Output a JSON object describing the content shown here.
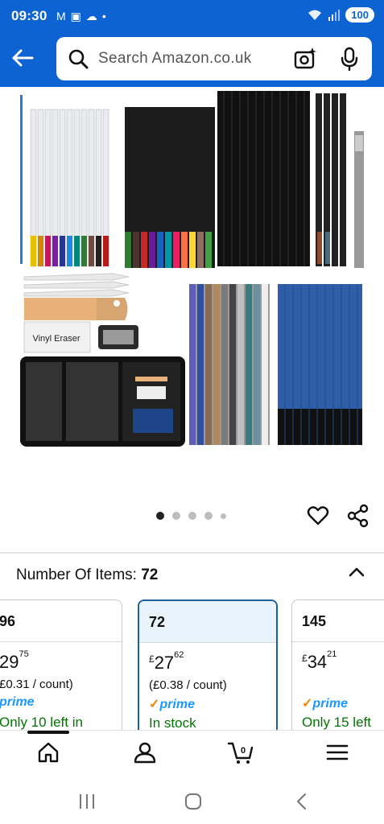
{
  "status": {
    "time": "09:30",
    "battery": "100"
  },
  "search": {
    "placeholder": "Search Amazon.co.uk"
  },
  "product_image": {
    "eraser_label": "Vinyl Eraser"
  },
  "variant": {
    "label": "Number Of Items:",
    "value": "72",
    "options": [
      {
        "title": "96",
        "price_currency": "£",
        "price_whole": "29",
        "price_fraction": "75",
        "per_count": "£0.31 / count)",
        "prime": "prime",
        "stock": "Only 10 left in"
      },
      {
        "title": "72",
        "price_currency": "£",
        "price_whole": "27",
        "price_fraction": "62",
        "per_count": "(£0.38 / count)",
        "prime": "prime",
        "stock": "In stock"
      },
      {
        "title": "145",
        "price_currency": "£",
        "price_whole": "34",
        "price_fraction": "21",
        "per_count": "",
        "prime": "prime",
        "stock": "Only 15 left"
      }
    ]
  },
  "colors": {
    "brand_blue": "#0e63d2",
    "selected_border": "#1f5f9a",
    "stock_green": "#007600",
    "prime_blue": "#1a98ff"
  }
}
